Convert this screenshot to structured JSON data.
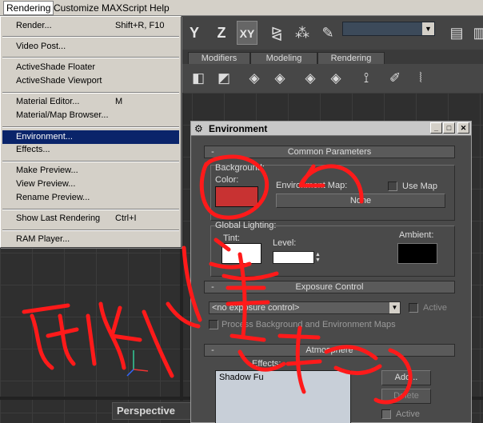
{
  "menubar": {
    "items": [
      {
        "label": "Rendering"
      },
      {
        "label": "Customize"
      },
      {
        "label": "MAXScript"
      },
      {
        "label": "Help"
      }
    ]
  },
  "toolbar": {
    "axis_y": "Y",
    "axis_z": "Z",
    "axis_xy": "XY"
  },
  "tabs": [
    {
      "label": "Modifiers"
    },
    {
      "label": "Modeling"
    },
    {
      "label": "Rendering"
    }
  ],
  "dropdown": {
    "render": {
      "label": "Render...",
      "shortcut": "Shift+R, F10"
    },
    "video_post": {
      "label": "Video Post..."
    },
    "activeshade_floater": {
      "label": "ActiveShade Floater"
    },
    "activeshade_viewport": {
      "label": "ActiveShade Viewport"
    },
    "material_editor": {
      "label": "Material Editor...",
      "shortcut": "M"
    },
    "material_map_browser": {
      "label": "Material/Map Browser..."
    },
    "environment": {
      "label": "Environment..."
    },
    "effects": {
      "label": "Effects..."
    },
    "make_preview": {
      "label": "Make Preview..."
    },
    "view_preview": {
      "label": "View Preview..."
    },
    "rename_preview": {
      "label": "Rename Preview..."
    },
    "show_last_rendering": {
      "label": "Show Last Rendering",
      "shortcut": "Ctrl+I"
    },
    "ram_player": {
      "label": "RAM Player..."
    }
  },
  "viewport": {
    "label": "Perspective"
  },
  "dialog": {
    "title": "Environment",
    "common_parameters": {
      "header": "Common Parameters",
      "background": {
        "group_label": "Background:",
        "color_label": "Color:",
        "color": "#c83232",
        "env_map_label": "Environment Map:",
        "env_map_button": "None",
        "use_map_label": "Use Map"
      },
      "global_lighting": {
        "group_label": "Global Lighting:",
        "tint_label": "Tint:",
        "tint_color": "#ffffff",
        "level_label": "Level:",
        "ambient_label": "Ambient:",
        "ambient_color": "#000000"
      }
    },
    "exposure_control": {
      "header": "Exposure Control",
      "selected": "<no exposure control>",
      "active_label": "Active",
      "process_label": "Process Background and Environment Maps"
    },
    "atmosphere": {
      "header": "Atmosphere",
      "effects_label": "Effects:",
      "effects_list": [
        "Shadow Fu"
      ],
      "add_label": "Add...",
      "delete_label": "Delete",
      "active_label": "Active"
    }
  },
  "colors": {
    "accent_selection": "#0a246a",
    "annotation_ink": "#ff1a1a"
  }
}
